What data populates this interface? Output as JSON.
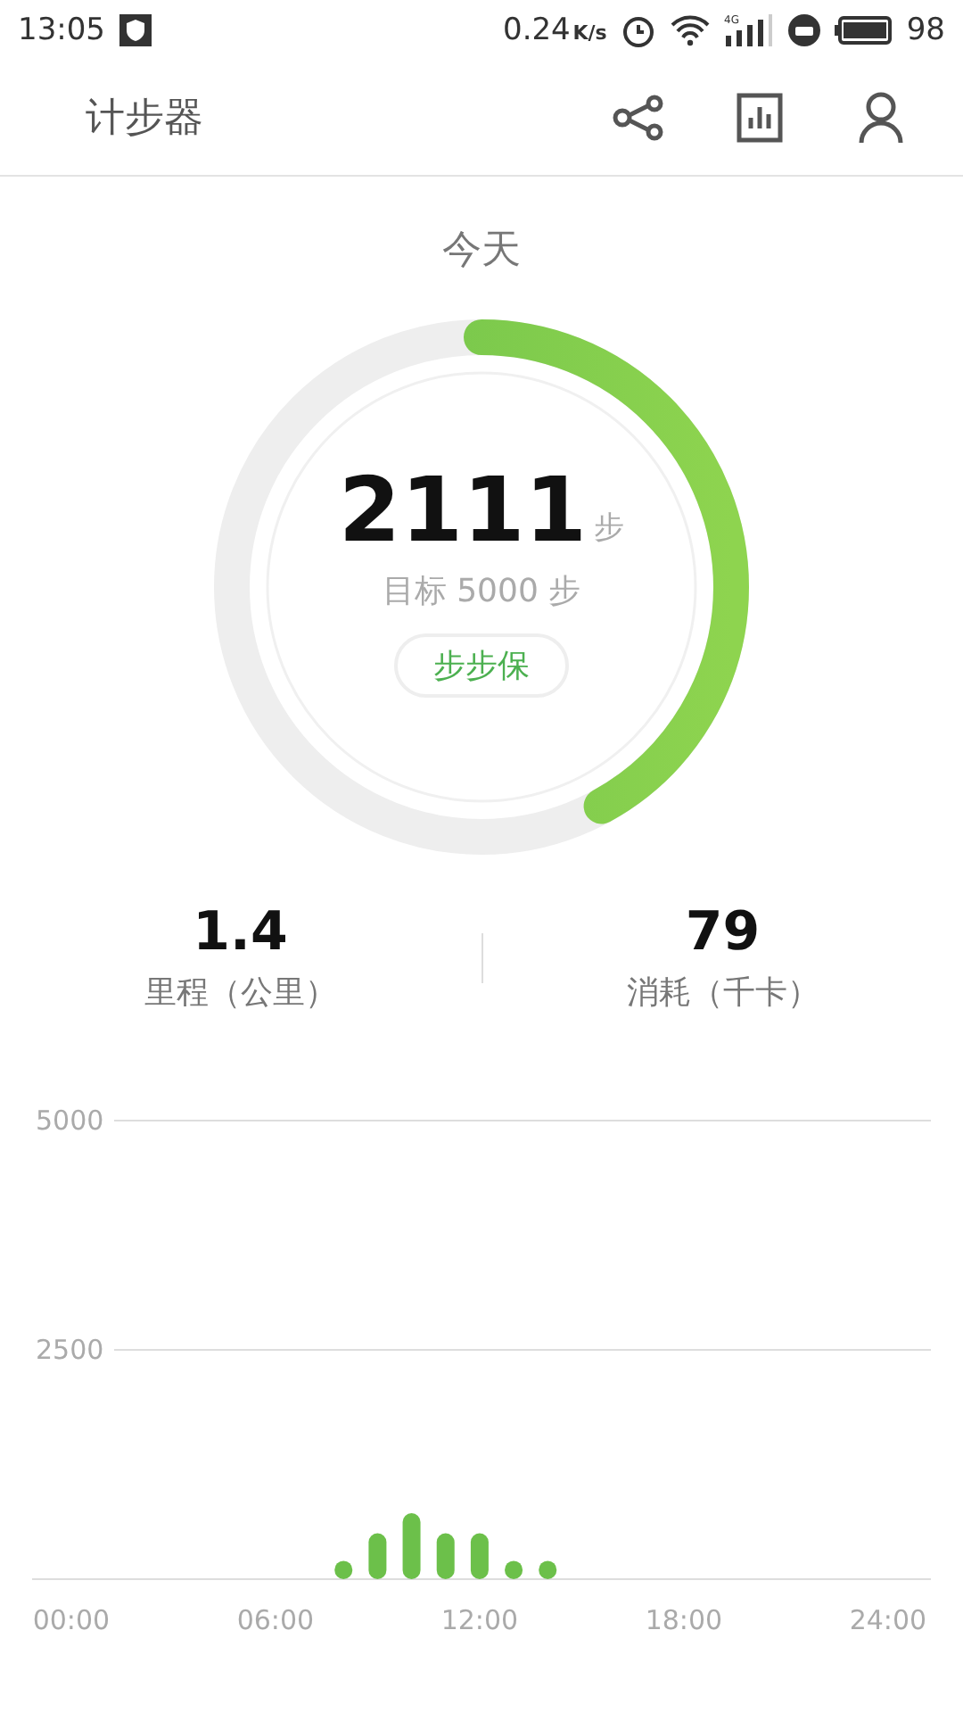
{
  "status_bar": {
    "time": "13:05",
    "speed": "0.24",
    "speed_unit": "K/s",
    "network": "4G",
    "battery": "98"
  },
  "app_bar": {
    "title": "计步器"
  },
  "today": {
    "label": "今天",
    "steps": "2111",
    "unit": "步",
    "goal": "目标 5000 步",
    "level": 0.42,
    "badge": "步步保"
  },
  "stats": [
    {
      "value": "1.4",
      "label": "里程（公里）"
    },
    {
      "value": "79",
      "label": "消耗（千卡）"
    }
  ],
  "chart_data": {
    "type": "bar",
    "x": [
      8,
      9,
      10,
      11,
      12,
      13,
      14
    ],
    "series": [
      {
        "color": "#6cc04a",
        "values": [
          200,
          500,
          720,
          500,
          500,
          200,
          200
        ]
      }
    ],
    "xlim": [
      -1.15,
      25.26
    ],
    "ylim": [
      0,
      5000
    ],
    "xticks": [
      {
        "value": 0,
        "label": "00:00"
      },
      {
        "value": 6,
        "label": "06:00"
      },
      {
        "value": 12,
        "label": "12:00"
      },
      {
        "value": 18,
        "label": "18:00"
      },
      {
        "value": 24,
        "label": "24:00"
      }
    ],
    "yticks": [
      {
        "value": 2500,
        "label": "2500"
      },
      {
        "value": 5000,
        "label": "5000"
      }
    ]
  }
}
